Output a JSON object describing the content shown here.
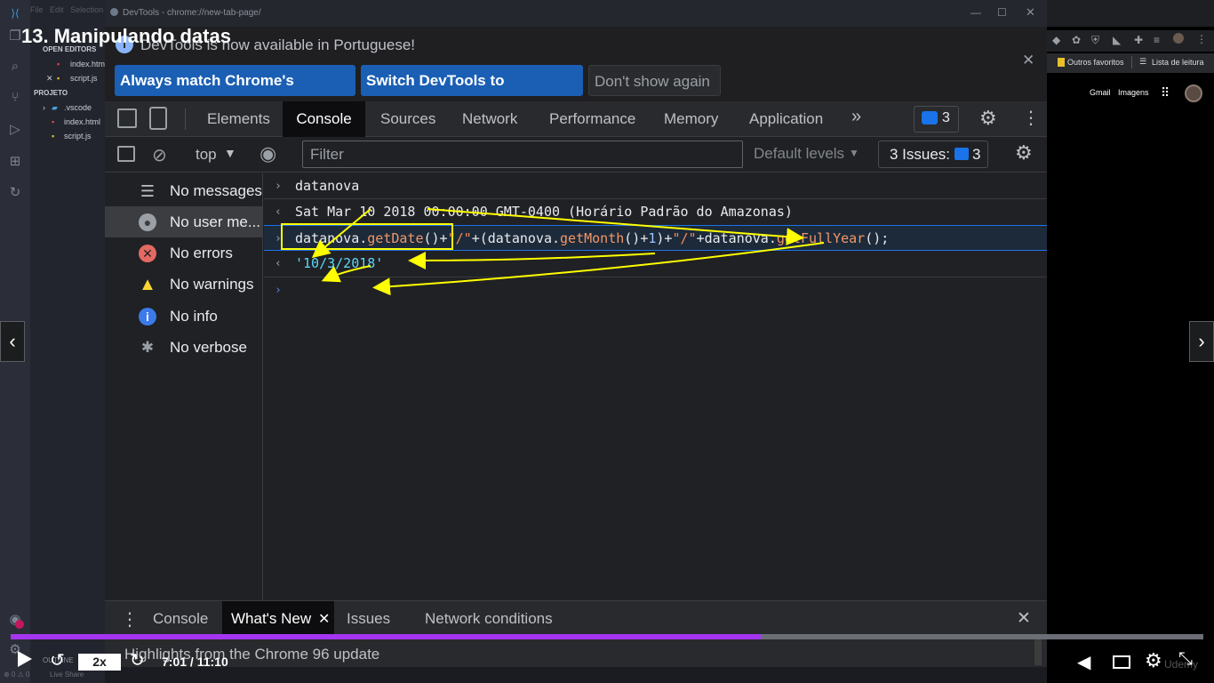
{
  "course": {
    "lecture_title": "13. Manipulando datas"
  },
  "vscode": {
    "menu": [
      "File",
      "Edit",
      "Selection"
    ],
    "open_editors_label": "OPEN EDITORS",
    "open_editors": [
      "index.html",
      "script.js"
    ],
    "project_label": "PROJETO",
    "tree": [
      ".vscode",
      "index.html",
      "script.js"
    ],
    "outline_label": "OUTLINE",
    "status_left": "⊗ 0 ⚠ 0",
    "status_live": "Live Share"
  },
  "window": {
    "title": "DevTools - chrome://new-tab-page/"
  },
  "banner": {
    "message": "DevTools is now available in Portuguese!",
    "buttons": [
      "Always match Chrome's language",
      "Switch DevTools to Portuguese",
      "Don't show again"
    ]
  },
  "tabs": {
    "items": [
      "Elements",
      "Console",
      "Sources",
      "Network",
      "Performance",
      "Memory",
      "Application"
    ],
    "active": "Console",
    "issues_badge": "3"
  },
  "filterbar": {
    "context": "top",
    "filter_placeholder": "Filter",
    "levels": "Default levels",
    "issues_label": "3 Issues:",
    "issues_count": "3"
  },
  "sidebar": {
    "items": [
      {
        "label": "No messages",
        "icon": "list-icon"
      },
      {
        "label": "No user me...",
        "icon": "user-icon"
      },
      {
        "label": "No errors",
        "icon": "error-icon"
      },
      {
        "label": "No warnings",
        "icon": "warning-icon"
      },
      {
        "label": "No info",
        "icon": "info-icon"
      },
      {
        "label": "No verbose",
        "icon": "bug-icon"
      }
    ]
  },
  "console": {
    "line1": "datanova",
    "line2": "Sat Mar 10 2018 00:00:00 GMT-0400 (Horário Padrão do Amazonas)",
    "line3_parts": [
      "datanova.",
      "getDate",
      "()+",
      "\"/\"",
      "+(datanova.",
      "getMonth",
      "()+",
      "1",
      ")+",
      "\"/\"",
      "+datanova.",
      "getFullYear",
      "();"
    ],
    "line4": "'10/3/2018'"
  },
  "drawer": {
    "tabs": [
      "Console",
      "What's New",
      "Issues",
      "Network conditions"
    ],
    "active": "What's New",
    "highlight": "Highlights from the Chrome 96 update"
  },
  "right_browser": {
    "bookmarks": [
      "Outros favoritos",
      "Lista de leitura"
    ],
    "links": [
      "Gmail",
      "Imagens"
    ]
  },
  "player": {
    "speed": "2x",
    "time": "7:01 / 11:10",
    "progress_fraction": 0.629,
    "watermark": "Udemy"
  },
  "colors": {
    "accent": "#a435f0",
    "devtools_bg": "#202124",
    "yellow": "#ffff00",
    "link_blue": "#1a5fb4"
  }
}
